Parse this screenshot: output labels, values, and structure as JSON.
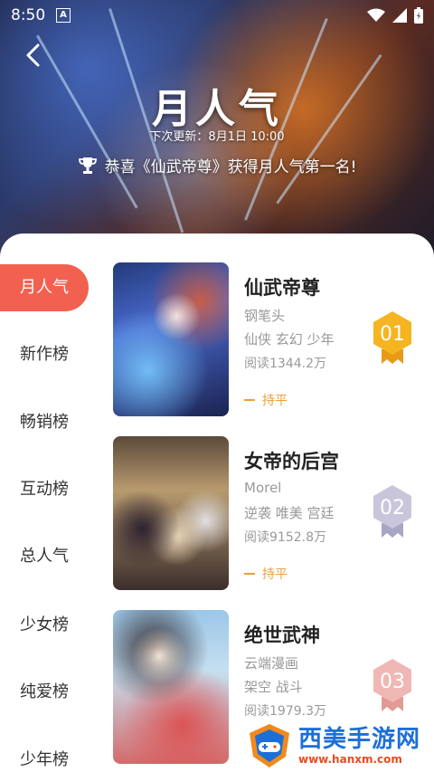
{
  "status_bar": {
    "time": "8:50",
    "badge": "A"
  },
  "hero": {
    "title": "月人气",
    "next_update": "下次更新：8月1日 10:00",
    "congrats": "恭喜《仙武帝尊》获得月人气第一名!"
  },
  "sidebar": {
    "items": [
      {
        "label": "月人气",
        "active": true
      },
      {
        "label": "新作榜",
        "active": false
      },
      {
        "label": "畅销榜",
        "active": false
      },
      {
        "label": "互动榜",
        "active": false
      },
      {
        "label": "总人气",
        "active": false
      },
      {
        "label": "少女榜",
        "active": false
      },
      {
        "label": "纯爱榜",
        "active": false
      },
      {
        "label": "少年榜",
        "active": false
      }
    ]
  },
  "list": [
    {
      "title": "仙武帝尊",
      "author": "钢笔头",
      "tags": "仙侠 玄幻 少年",
      "reads": "阅读1344.2万",
      "trend": "持平",
      "rank": "01",
      "medal_color": "#f4b521"
    },
    {
      "title": "女帝的后宫",
      "author": "Morel",
      "tags": "逆袭 唯美 宫廷",
      "reads": "阅读9152.8万",
      "trend": "持平",
      "rank": "02",
      "medal_color": "#c9c6dc"
    },
    {
      "title": "绝世武神",
      "author": "云端漫画",
      "tags": "架空 战斗",
      "reads": "阅读1979.3万",
      "trend": "",
      "rank": "03",
      "medal_color": "#efb8b4"
    }
  ],
  "watermark": {
    "text": "西美手游网",
    "url": "www.hanxm.com"
  },
  "colors": {
    "accent": "#f2614f",
    "trend": "#e8a13a"
  }
}
